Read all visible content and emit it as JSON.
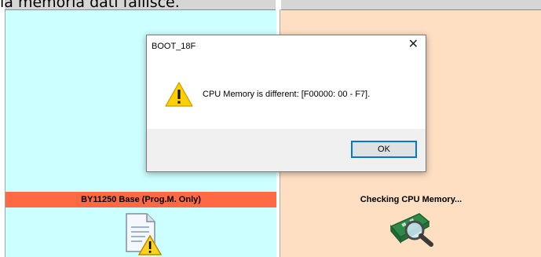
{
  "background_caption": "la memoria dati fallisce.",
  "dialog": {
    "title": "BOOT_18F",
    "close_glyph": "✕",
    "message": "CPU Memory is different: [F00000: 00 - F7].",
    "ok_label": "OK",
    "icon": "warning-icon"
  },
  "left_panel": {
    "status": "BY11250 Base (Prog.M. Only)",
    "status_color": "#ff6a44",
    "background_color": "#ccffff",
    "icon": "document-warning-icon"
  },
  "right_panel": {
    "status": "Checking CPU Memory...",
    "background_color": "#ffdfc2",
    "icon": "memory-search-icon"
  }
}
